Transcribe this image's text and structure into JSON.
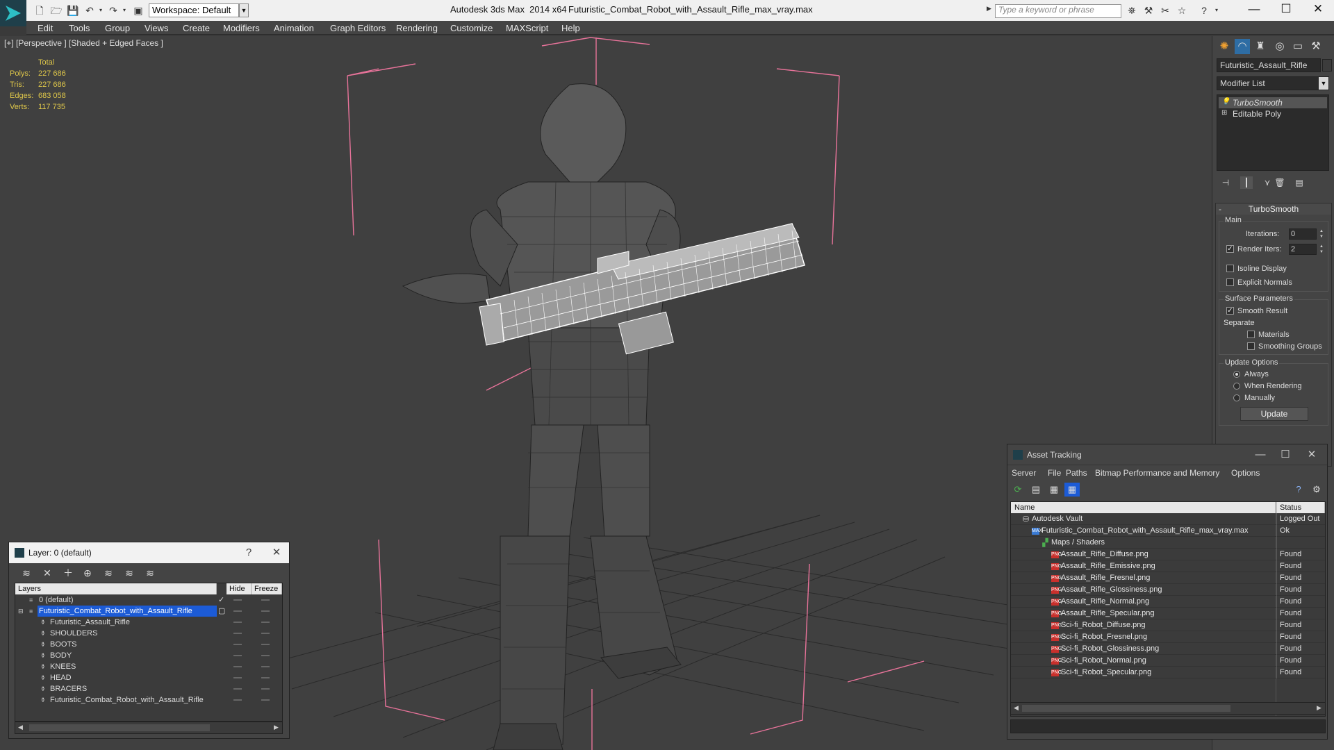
{
  "titlebar": {
    "workspace": "Workspace: Default",
    "app_title": "Autodesk 3ds Max  2014 x64",
    "file_title": "Futuristic_Combat_Robot_with_Assault_Rifle_max_vray.max",
    "search_placeholder": "Type a keyword or phrase"
  },
  "menubar": {
    "items": [
      "Edit",
      "Tools",
      "Group",
      "Views",
      "Create",
      "Modifiers",
      "Animation",
      "Graph Editors",
      "Rendering",
      "Customize",
      "MAXScript",
      "Help"
    ]
  },
  "viewport": {
    "label": "[+] [Perspective ] [Shaded + Edged Faces ]",
    "stats": {
      "total_label": "Total",
      "rows": [
        {
          "label": "Polys:",
          "value": "227 686"
        },
        {
          "label": "Tris:",
          "value": "227 686"
        },
        {
          "label": "Edges:",
          "value": "683 058"
        },
        {
          "label": "Verts:",
          "value": "117 735"
        }
      ]
    }
  },
  "command_panel": {
    "object_name": "Futuristic_Assault_Rifle",
    "modifier_list": "Modifier List",
    "stack": [
      "TurboSmooth",
      "Editable Poly"
    ],
    "turbosmooth": {
      "title": "TurboSmooth",
      "main_label": "Main",
      "iterations_label": "Iterations:",
      "iterations_value": "0",
      "render_iters_label": "Render Iters:",
      "render_iters_value": "2",
      "isoline_label": "Isoline Display",
      "explicit_normals_label": "Explicit Normals",
      "surface_params_label": "Surface Parameters",
      "smooth_result_label": "Smooth Result",
      "separate_label": "Separate",
      "materials_label": "Materials",
      "smoothing_groups_label": "Smoothing Groups",
      "update_options_label": "Update Options",
      "always_label": "Always",
      "when_rendering_label": "When Rendering",
      "manually_label": "Manually",
      "update_button": "Update"
    }
  },
  "layer_dialog": {
    "title": "Layer: 0 (default)",
    "help_glyph": "?",
    "columns": [
      "Layers",
      "Hide",
      "Freeze"
    ],
    "rows": [
      {
        "name": "0 (default)",
        "level": 0,
        "selected": false
      },
      {
        "name": "Futuristic_Combat_Robot_with_Assault_Rifle",
        "level": 0,
        "selected": true
      },
      {
        "name": "Futuristic_Assault_Rifle",
        "level": 1,
        "selected": false
      },
      {
        "name": "SHOULDERS",
        "level": 1,
        "selected": false
      },
      {
        "name": "BOOTS",
        "level": 1,
        "selected": false
      },
      {
        "name": "BODY",
        "level": 1,
        "selected": false
      },
      {
        "name": "KNEES",
        "level": 1,
        "selected": false
      },
      {
        "name": "HEAD",
        "level": 1,
        "selected": false
      },
      {
        "name": "BRACERS",
        "level": 1,
        "selected": false
      },
      {
        "name": "Futuristic_Combat_Robot_with_Assault_Rifle",
        "level": 1,
        "selected": false
      }
    ]
  },
  "asset_dialog": {
    "title": "Asset Tracking",
    "menu": [
      "Server",
      "File",
      "Paths",
      "Bitmap Performance and Memory",
      "Options"
    ],
    "columns": [
      "Name",
      "Status"
    ],
    "rows": [
      {
        "name": "Autodesk Vault",
        "status": "Logged Out",
        "icon": "vault",
        "level": 0
      },
      {
        "name": "Futuristic_Combat_Robot_with_Assault_Rifle_max_vray.max",
        "status": "Ok",
        "icon": "max",
        "level": 1
      },
      {
        "name": "Maps / Shaders",
        "status": "",
        "icon": "maps",
        "level": 2
      },
      {
        "name": "Assault_Rifle_Diffuse.png",
        "status": "Found",
        "icon": "png",
        "level": 3
      },
      {
        "name": "Assault_Rifle_Emissive.png",
        "status": "Found",
        "icon": "png",
        "level": 3
      },
      {
        "name": "Assault_Rifle_Fresnel.png",
        "status": "Found",
        "icon": "png",
        "level": 3
      },
      {
        "name": "Assault_Rifle_Glossiness.png",
        "status": "Found",
        "icon": "png",
        "level": 3
      },
      {
        "name": "Assault_Rifle_Normal.png",
        "status": "Found",
        "icon": "png",
        "level": 3
      },
      {
        "name": "Assault_Rifle_Specular.png",
        "status": "Found",
        "icon": "png",
        "level": 3
      },
      {
        "name": "Sci-fi_Robot_Diffuse.png",
        "status": "Found",
        "icon": "png",
        "level": 3
      },
      {
        "name": "Sci-fi_Robot_Fresnel.png",
        "status": "Found",
        "icon": "png",
        "level": 3
      },
      {
        "name": "Sci-fi_Robot_Glossiness.png",
        "status": "Found",
        "icon": "png",
        "level": 3
      },
      {
        "name": "Sci-fi_Robot_Normal.png",
        "status": "Found",
        "icon": "png",
        "level": 3
      },
      {
        "name": "Sci-fi_Robot_Specular.png",
        "status": "Found",
        "icon": "png",
        "level": 3
      }
    ]
  },
  "colors": {
    "viewport_bg": "#404040",
    "stats_text": "#e0c84a",
    "selection_blue": "#1c5bd6",
    "bbox_pink": "#e8739a"
  }
}
